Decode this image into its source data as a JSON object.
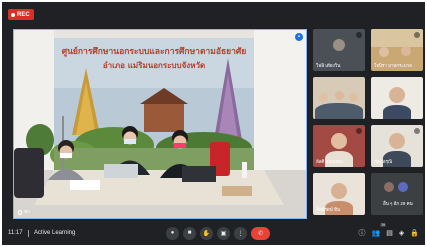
{
  "recording": {
    "label": "REC"
  },
  "main": {
    "presenter_label": "พร",
    "banner_line1": "ศูนย์การศึกษานอกระบบและการศึกษาตามอัธยาศัย",
    "banner_line2": "อำเภอ แม่ริมนอกระบบจังหวัด"
  },
  "participants": [
    {
      "name": "ใฟลิ เตียงวิน",
      "kind": "photo"
    },
    {
      "name": "ใจนิรา บาลกระบาล",
      "kind": "classroom"
    },
    {
      "name": "",
      "kind": "group"
    },
    {
      "name": "",
      "kind": "face"
    },
    {
      "name": "ลีลศิ ผลปนทน",
      "kind": "face"
    },
    {
      "name": "ก้อง อรุณิ",
      "kind": "face"
    },
    {
      "name": "สิทธิรัตน์ ทิม",
      "kind": "face"
    },
    {
      "name": "อื่น ๆ อีก 29 คน",
      "kind": "others"
    }
  ],
  "bottom_bar": {
    "time": "11:17",
    "meeting_title": "Active Learning",
    "participant_count": "39"
  },
  "icons": {
    "controls": [
      "mic-icon",
      "camera-icon",
      "hand-icon",
      "present-icon",
      "more-icon",
      "end-call-icon"
    ],
    "right": [
      "info-icon",
      "people-icon",
      "chat-icon",
      "activities-icon",
      "lock-icon"
    ]
  },
  "colors": {
    "background": "#202124",
    "end_call": "#ea4335",
    "rec": "#d93025",
    "active_border": "#8ab4f8"
  }
}
